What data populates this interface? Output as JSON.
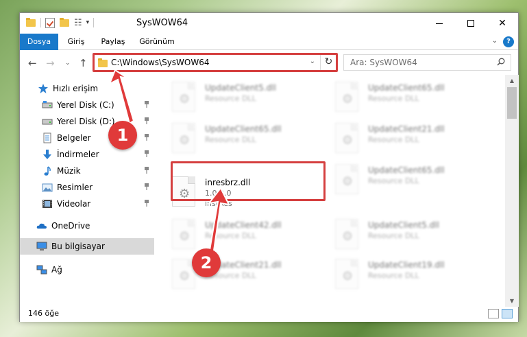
{
  "window": {
    "title": "SysWOW64"
  },
  "ribbon": {
    "tabs": [
      "Dosya",
      "Giriş",
      "Paylaş",
      "Görünüm"
    ]
  },
  "address": {
    "path": "C:\\Windows\\SysWOW64"
  },
  "search": {
    "placeholder": "Ara: SysWOW64"
  },
  "sidebar": {
    "items": [
      {
        "label": "Hızlı erişim",
        "icon": "star-icon"
      },
      {
        "label": "Yerel Disk (C:)",
        "icon": "drive-icon"
      },
      {
        "label": "Yerel Disk (D:)",
        "icon": "drive-icon"
      },
      {
        "label": "Belgeler",
        "icon": "document-icon"
      },
      {
        "label": "İndirmeler",
        "icon": "download-icon"
      },
      {
        "label": "Müzik",
        "icon": "music-icon"
      },
      {
        "label": "Resimler",
        "icon": "pictures-icon"
      },
      {
        "label": "Videolar",
        "icon": "video-icon"
      },
      {
        "label": "OneDrive",
        "icon": "cloud-icon"
      },
      {
        "label": "Bu bilgisayar",
        "icon": "computer-icon"
      },
      {
        "label": "Ağ",
        "icon": "network-icon"
      }
    ]
  },
  "files": [
    {
      "name": "UpdateClient5.dll",
      "desc": "Resource DLL"
    },
    {
      "name": "UpdateClient65.dll",
      "desc": "Resource DLL"
    },
    {
      "name": "UpdateClient65.dll",
      "desc": "Resource DLL"
    },
    {
      "name": "UpdateClient21.dll",
      "desc": "Resource DLL"
    },
    {
      "name": "inresbrz.dll",
      "version": "1.0.2.0",
      "desc": "instRes"
    },
    {
      "name": "UpdateClient65.dll",
      "desc": "Resource DLL"
    },
    {
      "name": "UpdateClient42.dll",
      "desc": "Resource DLL"
    },
    {
      "name": "UpdateClient5.dll",
      "desc": "Resource DLL"
    },
    {
      "name": "UpdateClient21.dll",
      "desc": "Resource DLL"
    },
    {
      "name": "UpdateClient19.dll",
      "desc": "Resource DLL"
    }
  ],
  "status": {
    "count": "146 öğe"
  },
  "callouts": [
    "1",
    "2"
  ],
  "colors": {
    "accent": "#1979ca",
    "highlight": "#d53f3f",
    "selected": "#d9d9d9"
  }
}
